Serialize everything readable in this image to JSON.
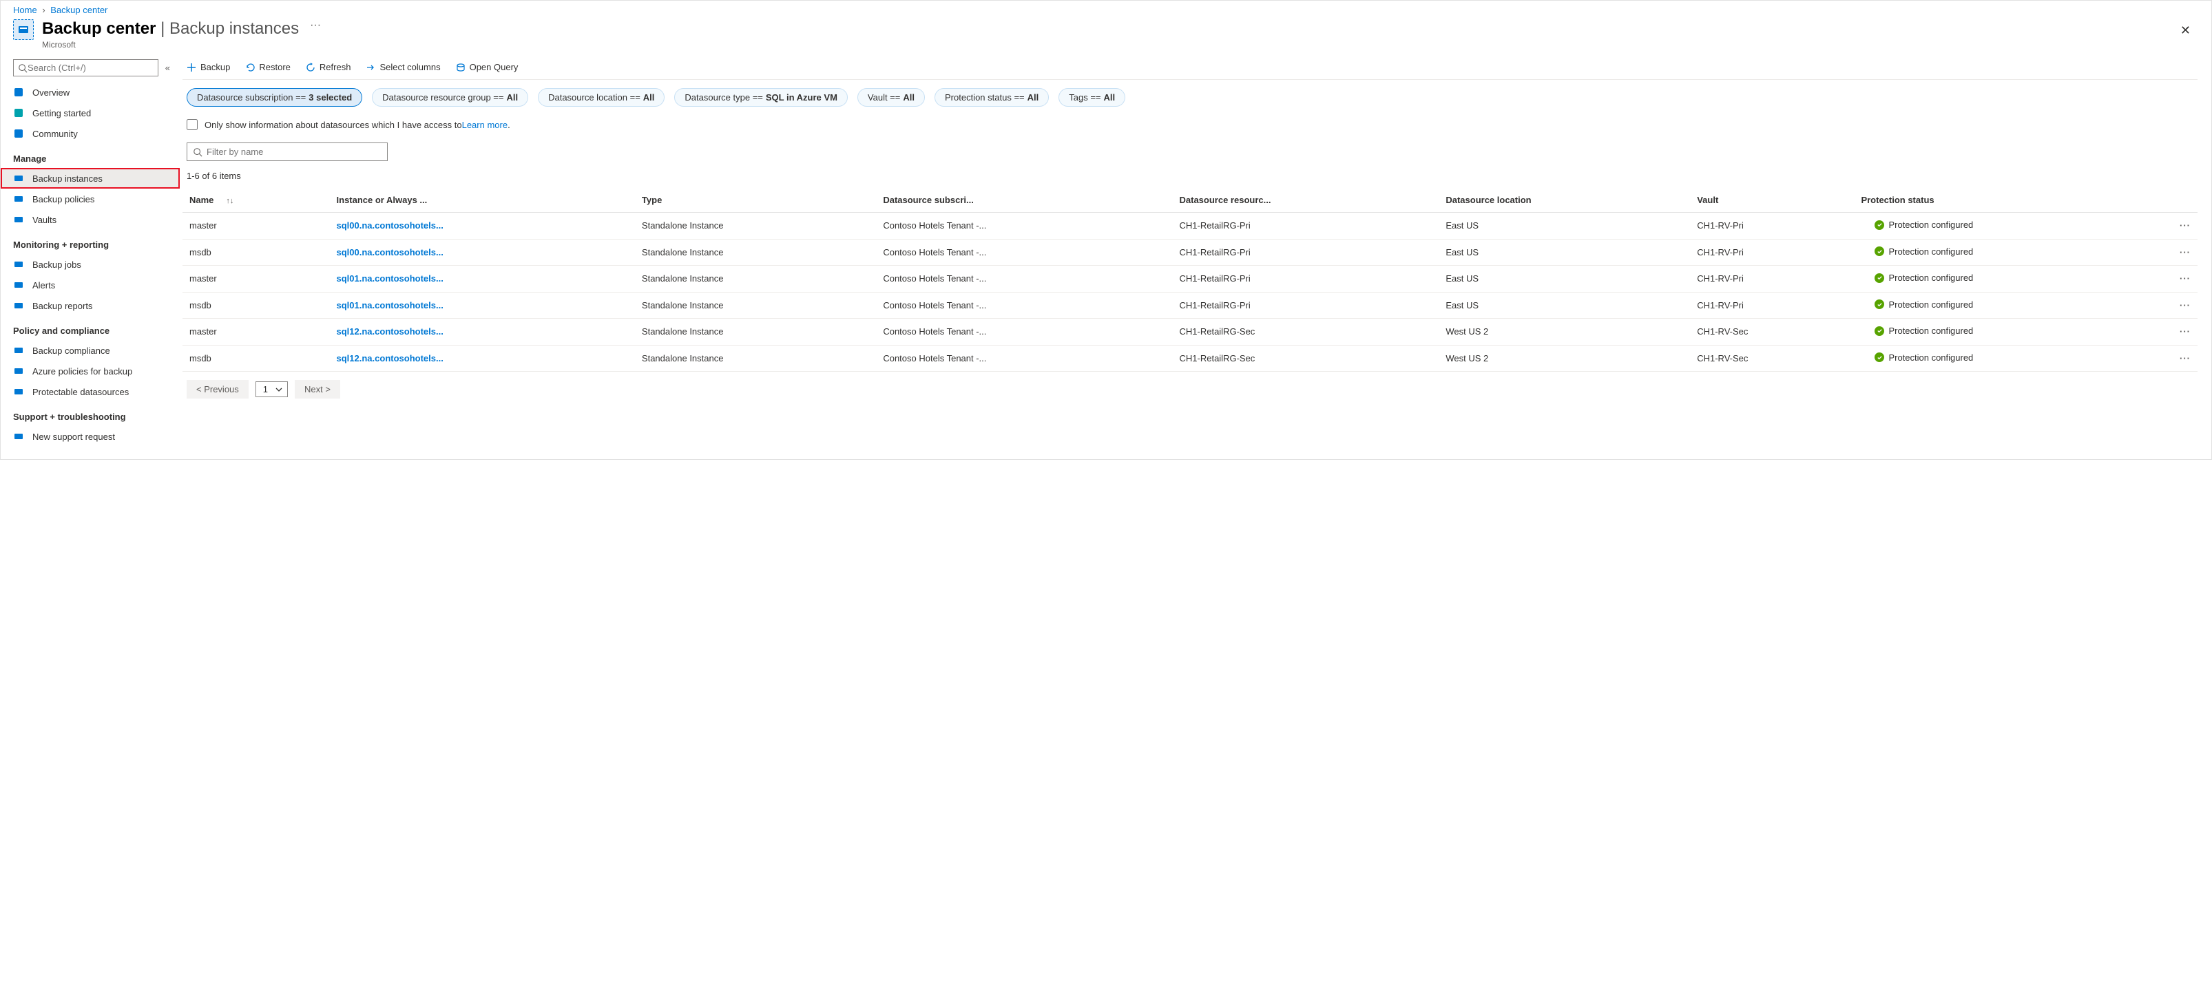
{
  "breadcrumb": {
    "home": "Home",
    "backup_center": "Backup center"
  },
  "header": {
    "title_main": "Backup center",
    "title_sub": "Backup instances",
    "subtitle": "Microsoft",
    "ellipsis": "···"
  },
  "sidebar": {
    "search_placeholder": "Search (Ctrl+/)",
    "items_top": [
      {
        "label": "Overview"
      },
      {
        "label": "Getting started"
      },
      {
        "label": "Community"
      }
    ],
    "groups": [
      {
        "title": "Manage",
        "items": [
          {
            "label": "Backup instances",
            "active": true
          },
          {
            "label": "Backup policies"
          },
          {
            "label": "Vaults"
          }
        ]
      },
      {
        "title": "Monitoring + reporting",
        "items": [
          {
            "label": "Backup jobs"
          },
          {
            "label": "Alerts"
          },
          {
            "label": "Backup reports"
          }
        ]
      },
      {
        "title": "Policy and compliance",
        "items": [
          {
            "label": "Backup compliance"
          },
          {
            "label": "Azure policies for backup"
          },
          {
            "label": "Protectable datasources"
          }
        ]
      },
      {
        "title": "Support + troubleshooting",
        "items": [
          {
            "label": "New support request"
          }
        ]
      }
    ]
  },
  "toolbar": {
    "backup": "Backup",
    "restore": "Restore",
    "refresh": "Refresh",
    "select_columns": "Select columns",
    "open_query": "Open Query"
  },
  "filters": [
    {
      "prefix": "Datasource subscription == ",
      "value": "3 selected",
      "selected": true
    },
    {
      "prefix": "Datasource resource group == ",
      "value": "All"
    },
    {
      "prefix": "Datasource location == ",
      "value": "All"
    },
    {
      "prefix": "Datasource type == ",
      "value": "SQL in Azure VM"
    },
    {
      "prefix": "Vault == ",
      "value": "All"
    },
    {
      "prefix": "Protection status == ",
      "value": "All"
    },
    {
      "prefix": "Tags == ",
      "value": "All"
    }
  ],
  "only_show": {
    "text": "Only show information about datasources which I have access to ",
    "learn": "Learn more"
  },
  "filter_placeholder": "Filter by name",
  "count_text": "1-6 of 6 items",
  "columns": [
    "Name",
    "Instance or Always ...",
    "Type",
    "Datasource subscri...",
    "Datasource resourc...",
    "Datasource location",
    "Vault",
    "Protection status"
  ],
  "rows": [
    {
      "name": "master",
      "instance": "sql00.na.contosohotels...",
      "type": "Standalone Instance",
      "sub": "Contoso Hotels Tenant -...",
      "rg": "CH1-RetailRG-Pri",
      "loc": "East US",
      "vault": "CH1-RV-Pri",
      "status": "Protection configured"
    },
    {
      "name": "msdb",
      "instance": "sql00.na.contosohotels...",
      "type": "Standalone Instance",
      "sub": "Contoso Hotels Tenant -...",
      "rg": "CH1-RetailRG-Pri",
      "loc": "East US",
      "vault": "CH1-RV-Pri",
      "status": "Protection configured"
    },
    {
      "name": "master",
      "instance": "sql01.na.contosohotels...",
      "type": "Standalone Instance",
      "sub": "Contoso Hotels Tenant -...",
      "rg": "CH1-RetailRG-Pri",
      "loc": "East US",
      "vault": "CH1-RV-Pri",
      "status": "Protection configured"
    },
    {
      "name": "msdb",
      "instance": "sql01.na.contosohotels...",
      "type": "Standalone Instance",
      "sub": "Contoso Hotels Tenant -...",
      "rg": "CH1-RetailRG-Pri",
      "loc": "East US",
      "vault": "CH1-RV-Pri",
      "status": "Protection configured"
    },
    {
      "name": "master",
      "instance": "sql12.na.contosohotels...",
      "type": "Standalone Instance",
      "sub": "Contoso Hotels Tenant -...",
      "rg": "CH1-RetailRG-Sec",
      "loc": "West US 2",
      "vault": "CH1-RV-Sec",
      "status": "Protection configured"
    },
    {
      "name": "msdb",
      "instance": "sql12.na.contosohotels...",
      "type": "Standalone Instance",
      "sub": "Contoso Hotels Tenant -...",
      "rg": "CH1-RetailRG-Sec",
      "loc": "West US 2",
      "vault": "CH1-RV-Sec",
      "status": "Protection configured"
    }
  ],
  "pager": {
    "prev": "< Previous",
    "page": "1",
    "next": "Next >"
  }
}
